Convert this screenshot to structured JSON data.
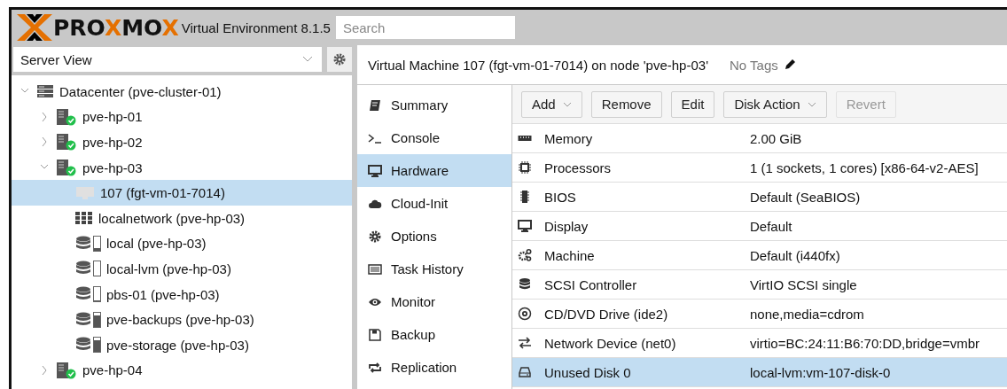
{
  "header": {
    "logo": [
      {
        "text": "PRO",
        "accent": false
      },
      {
        "text": "X",
        "accent": true
      },
      {
        "text": "MO",
        "accent": false
      },
      {
        "text": "X",
        "accent": true
      }
    ],
    "product": "Virtual Environment 8.1.5",
    "search": {
      "placeholder": "Search"
    }
  },
  "sidebar": {
    "view": "Server View",
    "tree": [
      {
        "kind": "datacenter",
        "label": "Datacenter (pve-cluster-01)",
        "expanded": true,
        "selected": false,
        "children": [
          {
            "kind": "node",
            "label": "pve-hp-01",
            "expanded": false,
            "selected": false
          },
          {
            "kind": "node",
            "label": "pve-hp-02",
            "expanded": false,
            "selected": false
          },
          {
            "kind": "node",
            "label": "pve-hp-03",
            "expanded": true,
            "selected": false,
            "children": [
              {
                "kind": "vm",
                "label": "107 (fgt-vm-01-7014)",
                "selected": true
              },
              {
                "kind": "sdn",
                "label": "localnetwork (pve-hp-03)",
                "selected": false
              },
              {
                "kind": "storage",
                "label": "local (pve-hp-03)",
                "level": 0.15,
                "selected": false
              },
              {
                "kind": "storage",
                "label": "local-lvm (pve-hp-03)",
                "level": 0.05,
                "selected": false
              },
              {
                "kind": "storage",
                "label": "pbs-01 (pve-hp-03)",
                "level": 0.05,
                "selected": false
              },
              {
                "kind": "storage",
                "label": "pve-backups (pve-hp-03)",
                "level": 0.8,
                "selected": false
              },
              {
                "kind": "storage",
                "label": "pve-storage (pve-hp-03)",
                "level": 0.8,
                "selected": false
              }
            ]
          },
          {
            "kind": "node",
            "label": "pve-hp-04",
            "expanded": false,
            "selected": false
          }
        ]
      }
    ]
  },
  "content": {
    "title": "Virtual Machine 107 (fgt-vm-01-7014) on node 'pve-hp-03'",
    "tags": "No Tags",
    "nav": [
      {
        "kind": "summary",
        "label": "Summary",
        "selected": false
      },
      {
        "kind": "console",
        "label": "Console",
        "selected": false
      },
      {
        "kind": "hardware",
        "label": "Hardware",
        "selected": true
      },
      {
        "kind": "cloud",
        "label": "Cloud-Init",
        "selected": false
      },
      {
        "kind": "options",
        "label": "Options",
        "selected": false
      },
      {
        "kind": "tasks",
        "label": "Task History",
        "selected": false
      },
      {
        "kind": "monitor",
        "label": "Monitor",
        "selected": false
      },
      {
        "kind": "backup",
        "label": "Backup",
        "selected": false
      },
      {
        "kind": "replication",
        "label": "Replication",
        "selected": false
      }
    ],
    "toolbar": [
      {
        "label": "Add",
        "dropdown": true,
        "disabled": false
      },
      {
        "label": "Remove",
        "dropdown": false,
        "disabled": false
      },
      {
        "label": "Edit",
        "dropdown": false,
        "disabled": false
      },
      {
        "label": "Disk Action",
        "dropdown": true,
        "disabled": false
      },
      {
        "label": "Revert",
        "dropdown": false,
        "disabled": true
      }
    ],
    "hardware": [
      {
        "kind": "memory",
        "name": "Memory",
        "value": "2.00 GiB",
        "selected": false
      },
      {
        "kind": "cpu",
        "name": "Processors",
        "value": "1 (1 sockets, 1 cores) [x86-64-v2-AES]",
        "selected": false
      },
      {
        "kind": "bios",
        "name": "BIOS",
        "value": "Default (SeaBIOS)",
        "selected": false
      },
      {
        "kind": "display",
        "name": "Display",
        "value": "Default",
        "selected": false
      },
      {
        "kind": "machine",
        "name": "Machine",
        "value": "Default (i440fx)",
        "selected": false
      },
      {
        "kind": "scsi",
        "name": "SCSI Controller",
        "value": "VirtIO SCSI single",
        "selected": false
      },
      {
        "kind": "cdrom",
        "name": "CD/DVD Drive (ide2)",
        "value": "none,media=cdrom",
        "selected": false
      },
      {
        "kind": "network",
        "name": "Network Device (net0)",
        "value": "virtio=BC:24:11:B6:70:DD,bridge=vmbr",
        "selected": false
      },
      {
        "kind": "disk",
        "name": "Unused Disk 0",
        "value": "local-lvm:vm-107-disk-0",
        "selected": true
      }
    ]
  }
}
